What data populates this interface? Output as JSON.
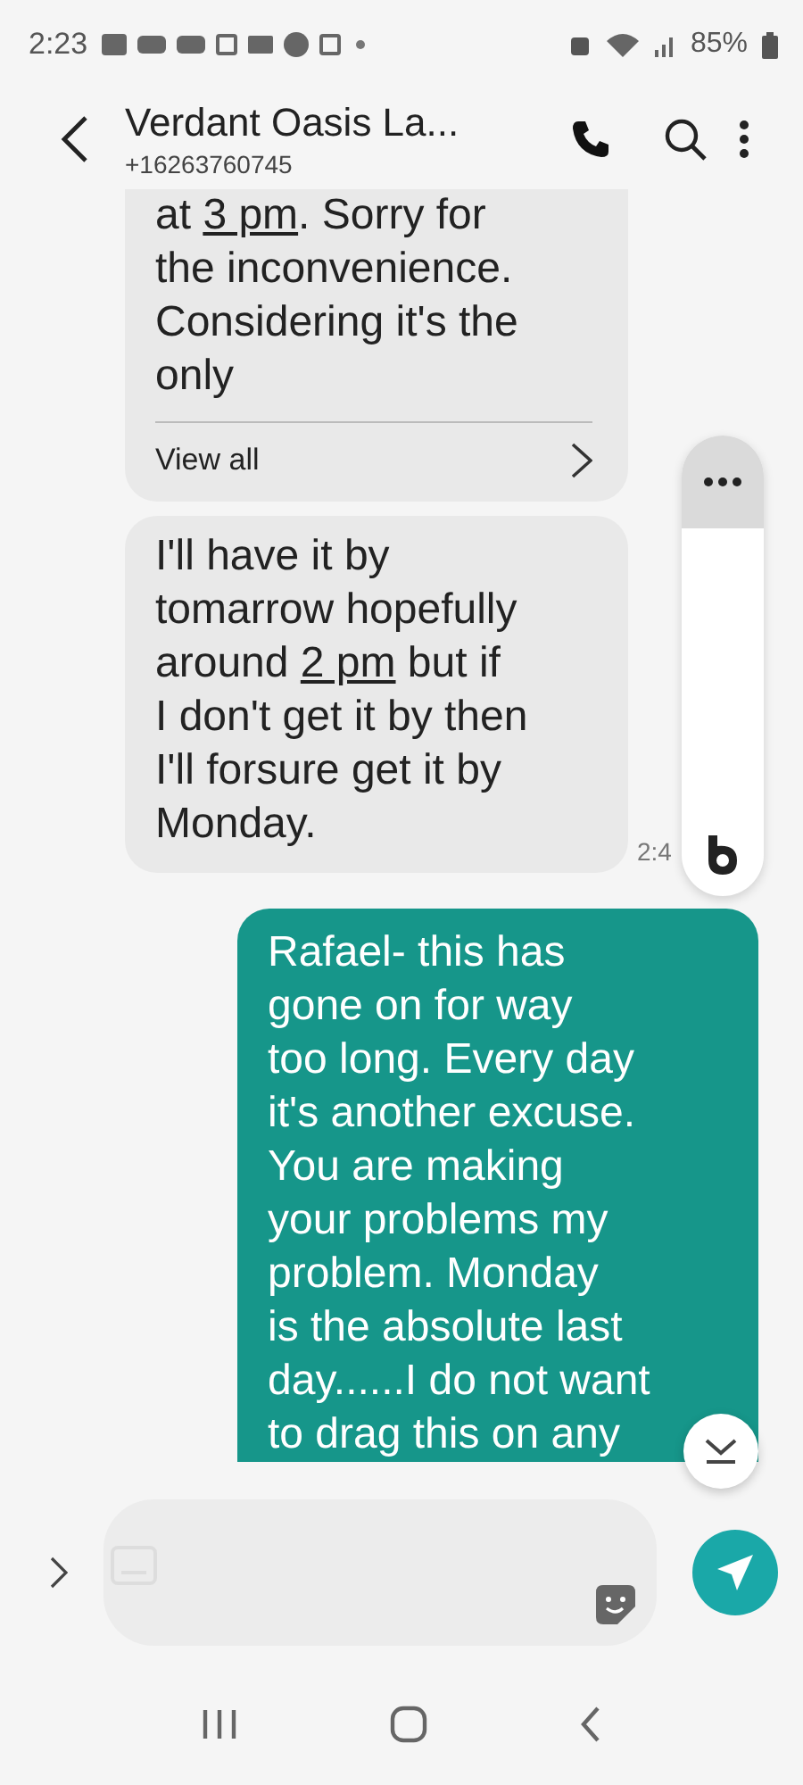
{
  "status_bar": {
    "time": "2:23",
    "battery": "85%"
  },
  "header": {
    "title": "Verdant Oasis La...",
    "subtitle": "+16263760745"
  },
  "messages": [
    {
      "kind": "incoming",
      "lines": [
        [
          {
            "text": "at "
          },
          {
            "text": "3 pm",
            "underlined": true
          },
          {
            "text": ". Sorry for"
          }
        ],
        [
          {
            "text": "the inconvenience."
          }
        ],
        [
          {
            "text": "Considering it's the"
          }
        ],
        [
          {
            "text": "only"
          }
        ]
      ],
      "view_all": "View all"
    },
    {
      "kind": "incoming",
      "lines": [
        [
          {
            "text": "I'll have it by"
          }
        ],
        [
          {
            "text": "tomarrow hopefully"
          }
        ],
        [
          {
            "text": "around "
          },
          {
            "text": "2 pm",
            "underlined": true
          },
          {
            "text": " but if"
          }
        ],
        [
          {
            "text": "I don't get it by then"
          }
        ],
        [
          {
            "text": "I'll forsure get it by"
          }
        ],
        [
          {
            "text": "Monday."
          }
        ]
      ],
      "time": "2:4"
    },
    {
      "kind": "outgoing",
      "lines": [
        [
          {
            "text": "Rafael- this has"
          }
        ],
        [
          {
            "text": "gone on for way"
          }
        ],
        [
          {
            "text": "too long. Every day"
          }
        ],
        [
          {
            "text": "it's another excuse."
          }
        ],
        [
          {
            "text": "You are making"
          }
        ],
        [
          {
            "text": "your problems my"
          }
        ],
        [
          {
            "text": "problem. Monday"
          }
        ],
        [
          {
            "text": "is the absolute last"
          }
        ],
        [
          {
            "text": "day......I do not want"
          }
        ],
        [
          {
            "text": "to drag this on any"
          }
        ]
      ]
    }
  ]
}
